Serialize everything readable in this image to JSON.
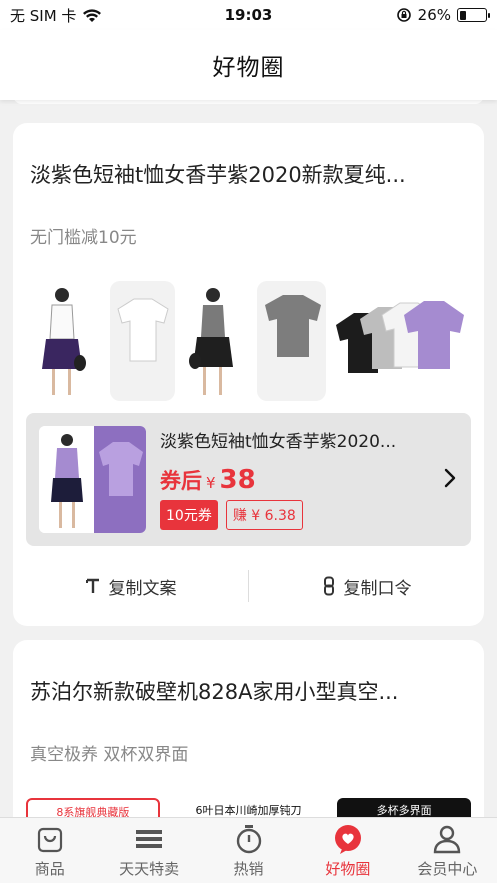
{
  "status_bar": {
    "carrier": "无 SIM 卡",
    "time": "19:03",
    "battery": "26%",
    "battery_level": 0.26
  },
  "header": {
    "title": "好物圈"
  },
  "posts": [
    {
      "title": "淡紫色短袖t恤女香芋紫2020新款夏纯...",
      "subtitle": "无门槛减10元",
      "product": {
        "name": "淡紫色短袖t恤女香芋紫2020...",
        "price_label": "券后",
        "currency": "¥",
        "price": "38",
        "coupon_tag": "10元券",
        "earn_tag": "赚 ¥ 6.38"
      },
      "actions": {
        "copy_text": "复制文案",
        "copy_code": "复制口令"
      }
    },
    {
      "title": "苏泊尔新款破壁机828A家用小型真空...",
      "subtitle": "真空极养 双杯双界面",
      "banners": [
        "8系旗舰典藏版",
        "6叶日本川崎加厚钝刀",
        "多杯多界面"
      ]
    }
  ],
  "tab_bar": {
    "items": [
      {
        "label": "商品",
        "icon": "bag-icon"
      },
      {
        "label": "天天特卖",
        "icon": "list-icon"
      },
      {
        "label": "热销",
        "icon": "stopwatch-icon"
      },
      {
        "label": "好物圈",
        "icon": "heart-bubble-icon",
        "active": true
      },
      {
        "label": "会员中心",
        "icon": "person-icon"
      }
    ]
  },
  "colors": {
    "accent": "#e8343c",
    "lavender": "#a58bd0"
  }
}
